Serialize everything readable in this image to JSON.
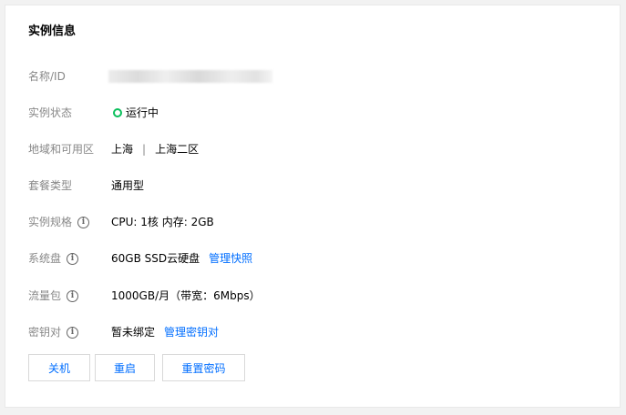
{
  "title": "实例信息",
  "rows": {
    "name": {
      "label": "名称/ID"
    },
    "status": {
      "label": "实例状态",
      "value": "运行中",
      "color": "#0abf5b"
    },
    "region": {
      "label": "地域和可用区",
      "region": "上海",
      "separator": "|",
      "zone": "上海二区"
    },
    "package": {
      "label": "套餐类型",
      "value": "通用型"
    },
    "spec": {
      "label": "实例规格",
      "value": "CPU: 1核 内存: 2GB"
    },
    "disk": {
      "label": "系统盘",
      "value": "60GB SSD云硬盘",
      "link": "管理快照"
    },
    "traffic": {
      "label": "流量包",
      "value": "1000GB/月（带宽：6Mbps）"
    },
    "keypair": {
      "label": "密钥对",
      "value": "暂未绑定",
      "link": "管理密钥对"
    }
  },
  "buttons": {
    "shutdown": "关机",
    "restart": "重启",
    "reset_password": "重置密码"
  },
  "icons": {
    "info": "i"
  },
  "colors": {
    "link": "#006eff",
    "running": "#0abf5b",
    "label": "#888888"
  }
}
